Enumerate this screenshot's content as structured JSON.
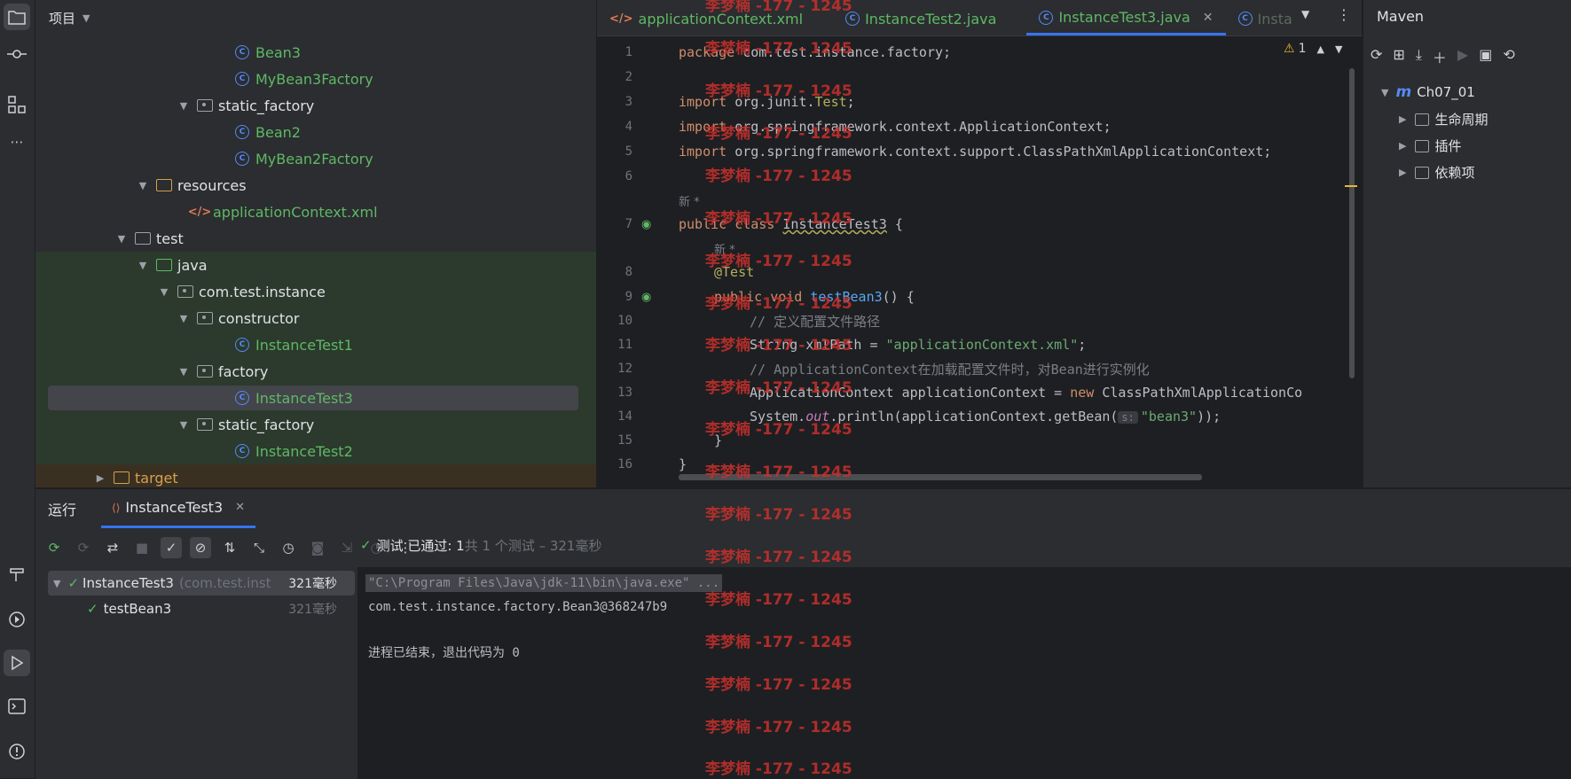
{
  "activity_bar": {
    "icons": [
      "project-icon",
      "commit-icon",
      "structure-icon",
      "more-icon",
      "build-icon",
      "services-icon",
      "run-icon",
      "terminal-icon",
      "problems-icon"
    ]
  },
  "project": {
    "header": "项目",
    "tree": [
      {
        "label": "Bean3",
        "kind": "class",
        "color": "green"
      },
      {
        "label": "MyBean3Factory",
        "kind": "class",
        "color": "green"
      },
      {
        "label": "static_factory",
        "kind": "package",
        "color": "white"
      },
      {
        "label": "Bean2",
        "kind": "class",
        "color": "green"
      },
      {
        "label": "MyBean2Factory",
        "kind": "class",
        "color": "green"
      },
      {
        "label": "resources",
        "kind": "resources",
        "color": "white"
      },
      {
        "label": "applicationContext.xml",
        "kind": "xml",
        "color": "green"
      },
      {
        "label": "test",
        "kind": "folder",
        "color": "white"
      },
      {
        "label": "java",
        "kind": "folder",
        "color": "white"
      },
      {
        "label": "com.test.instance",
        "kind": "package",
        "color": "white"
      },
      {
        "label": "constructor",
        "kind": "package",
        "color": "white"
      },
      {
        "label": "InstanceTest1",
        "kind": "class",
        "color": "green"
      },
      {
        "label": "factory",
        "kind": "package",
        "color": "white"
      },
      {
        "label": "InstanceTest3",
        "kind": "class",
        "color": "green"
      },
      {
        "label": "static_factory",
        "kind": "package",
        "color": "white"
      },
      {
        "label": "InstanceTest2",
        "kind": "class",
        "color": "green"
      },
      {
        "label": "target",
        "kind": "folder",
        "color": "orange"
      }
    ]
  },
  "editor": {
    "tabs": [
      {
        "label": "applicationContext.xml",
        "kind": "xml"
      },
      {
        "label": "InstanceTest2.java",
        "kind": "class"
      },
      {
        "label": "InstanceTest3.java",
        "kind": "class",
        "active": true
      },
      {
        "label": "Insta",
        "kind": "class"
      }
    ],
    "warning_count": "1",
    "hint_new": "新 *",
    "lines": {
      "l1": {
        "num": "1",
        "text": "package com.test.instance.factory;"
      },
      "l2": {
        "num": "2"
      },
      "l3": {
        "num": "3",
        "kw": "import ",
        "text": "org.junit.",
        "ann": "Test",
        "tail": ";"
      },
      "l4": {
        "num": "4",
        "kw": "import ",
        "text": "org.springframework.context.ApplicationContext;"
      },
      "l5": {
        "num": "5",
        "kw": "import ",
        "text": "org.springframework.context.support.ClassPathXmlApplicationContext;"
      },
      "l6": {
        "num": "6"
      },
      "l7": {
        "num": "7",
        "kw": "public class ",
        "text": "InstanceTest3",
        "tail": " {"
      },
      "l8": {
        "num": "8",
        "text": "@Test"
      },
      "l9": {
        "num": "9",
        "kw": "public void ",
        "fn": "testBean3",
        "tail": "() {"
      },
      "l10": {
        "num": "10",
        "text": "// 定义配置文件路径"
      },
      "l11": {
        "num": "11",
        "text": "String xmlPath = ",
        "str": "\"applicationContext.xml\"",
        "tail": ";"
      },
      "l12": {
        "num": "12",
        "text": "// ApplicationContext在加载配置文件时，对Bean进行实例化"
      },
      "l13": {
        "num": "13",
        "text": "ApplicationContext applicationContext = ",
        "kw": "new ",
        "tail": "ClassPathXmlApplicationCo"
      },
      "l14": {
        "num": "14",
        "text": "System.",
        "it": "out",
        "mid": ".println(applicationContext.getBean(",
        "hint": "s:",
        "str": "\"bean3\"",
        "tail": "));"
      },
      "l15": {
        "num": "15",
        "text": "}"
      },
      "l16": {
        "num": "16",
        "text": "}"
      }
    }
  },
  "maven": {
    "title": "Maven",
    "project": "Ch07_01",
    "items": [
      "生命周期",
      "插件",
      "依赖项"
    ]
  },
  "run": {
    "label": "运行",
    "tab": "InstanceTest3",
    "tree": {
      "root_label": "InstanceTest3",
      "root_pkg": "(com.test.inst",
      "root_time": "321毫秒",
      "child_label": "testBean3",
      "child_time": "321毫秒"
    },
    "status": {
      "passed": "测试 已通过: 1",
      "summary": "共 1 个测试 – 321毫秒"
    },
    "console": [
      "\"C:\\Program Files\\Java\\jdk-11\\bin\\java.exe\" ...",
      "com.test.instance.factory.Bean3@368247b9",
      "",
      "进程已结束，退出代码为 0"
    ]
  },
  "watermark": "李梦楠 -177 - 1245",
  "colors": {
    "accent": "#3574f0",
    "success": "#5fb865",
    "watermark": "#c9302c"
  }
}
